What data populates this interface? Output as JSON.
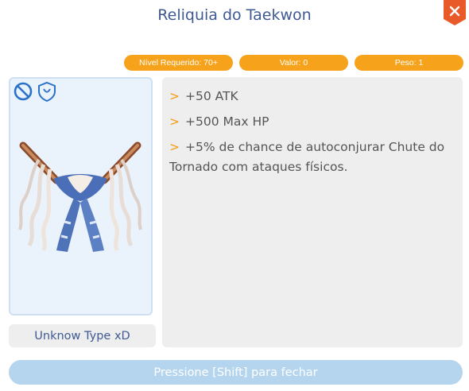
{
  "window": {
    "title": "Reliquia do Taekwon"
  },
  "stats": {
    "level": "Nível Requerido: 70+",
    "value": "Valor: 0",
    "weight": "Peso: 1"
  },
  "item": {
    "type": "Unknow Type xD",
    "badges": [
      "no-trade-icon",
      "shield-icon"
    ]
  },
  "description": {
    "bullet": ">",
    "lines": [
      "+50 ATK",
      "+500 Max HP",
      "+5% de chance de autoconjurar Chute do Tornado com ataques físicos."
    ]
  },
  "footer": {
    "hint": "Pressione [Shift] para fechar"
  },
  "colors": {
    "title": "#3f5a92",
    "accent": "#f6a21a",
    "close": "#e85a2a",
    "footer": "#b5d5ef",
    "panel_border": "#cfe0f4"
  }
}
